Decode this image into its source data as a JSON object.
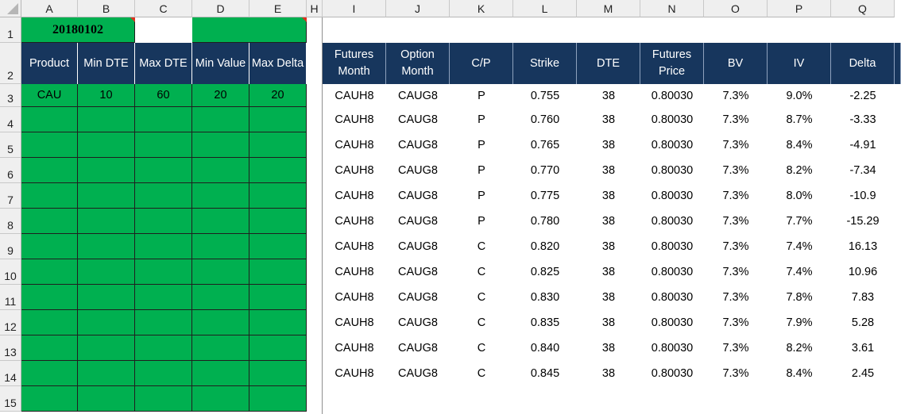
{
  "columns": [
    "A",
    "B",
    "C",
    "D",
    "E",
    "H",
    "I",
    "J",
    "K",
    "L",
    "M",
    "N",
    "O",
    "P",
    "Q"
  ],
  "rows": [
    "1",
    "2",
    "3",
    "4",
    "5",
    "6",
    "7",
    "8",
    "9",
    "10",
    "11",
    "12",
    "13",
    "14",
    "15"
  ],
  "input_block": {
    "date": "20180102",
    "headers": [
      "Product",
      "Min DTE",
      "Max DTE",
      "Min Value",
      "Max Delta"
    ],
    "values": [
      "CAU",
      "10",
      "60",
      "20",
      "20"
    ]
  },
  "results_block": {
    "headers": [
      "Futures Month",
      "Option Month",
      "C/P",
      "Strike",
      "DTE",
      "Futures Price",
      "BV",
      "IV",
      "Delta"
    ],
    "rows": [
      [
        "CAUH8",
        "CAUG8",
        "P",
        "0.755",
        "38",
        "0.80030",
        "7.3%",
        "9.0%",
        "-2.25"
      ],
      [
        "CAUH8",
        "CAUG8",
        "P",
        "0.760",
        "38",
        "0.80030",
        "7.3%",
        "8.7%",
        "-3.33"
      ],
      [
        "CAUH8",
        "CAUG8",
        "P",
        "0.765",
        "38",
        "0.80030",
        "7.3%",
        "8.4%",
        "-4.91"
      ],
      [
        "CAUH8",
        "CAUG8",
        "P",
        "0.770",
        "38",
        "0.80030",
        "7.3%",
        "8.2%",
        "-7.34"
      ],
      [
        "CAUH8",
        "CAUG8",
        "P",
        "0.775",
        "38",
        "0.80030",
        "7.3%",
        "8.0%",
        "-10.9"
      ],
      [
        "CAUH8",
        "CAUG8",
        "P",
        "0.780",
        "38",
        "0.80030",
        "7.3%",
        "7.7%",
        "-15.29"
      ],
      [
        "CAUH8",
        "CAUG8",
        "C",
        "0.820",
        "38",
        "0.80030",
        "7.3%",
        "7.4%",
        "16.13"
      ],
      [
        "CAUH8",
        "CAUG8",
        "C",
        "0.825",
        "38",
        "0.80030",
        "7.3%",
        "7.4%",
        "10.96"
      ],
      [
        "CAUH8",
        "CAUG8",
        "C",
        "0.830",
        "38",
        "0.80030",
        "7.3%",
        "7.8%",
        "7.83"
      ],
      [
        "CAUH8",
        "CAUG8",
        "C",
        "0.835",
        "38",
        "0.80030",
        "7.3%",
        "7.9%",
        "5.28"
      ],
      [
        "CAUH8",
        "CAUG8",
        "C",
        "0.840",
        "38",
        "0.80030",
        "7.3%",
        "8.2%",
        "3.61"
      ],
      [
        "CAUH8",
        "CAUG8",
        "C",
        "0.845",
        "38",
        "0.80030",
        "7.3%",
        "8.4%",
        "2.45"
      ]
    ]
  },
  "colors": {
    "input_green": "#00b050",
    "header_navy": "#17365d",
    "comment_red": "#e0301e"
  }
}
